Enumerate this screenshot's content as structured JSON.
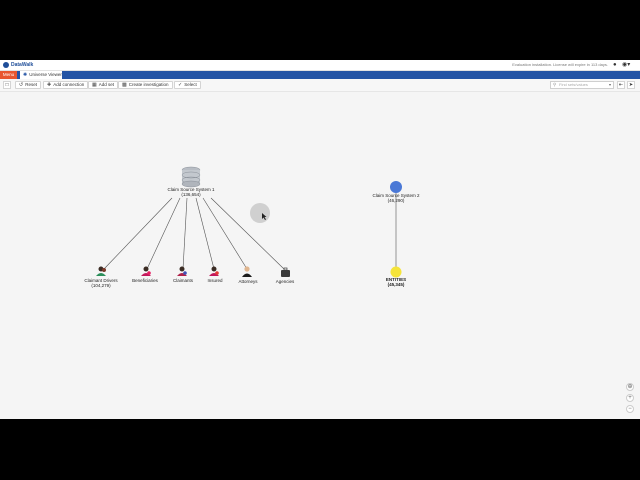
{
  "app": {
    "brand": "DataWalk",
    "evaluation_message": "Evaluation installation. License will expire in 113 days.",
    "menu_label": "Menu",
    "active_tab": "Universe Viewer"
  },
  "toolbar": {
    "reset": "Reset",
    "add_connection": "Add connection",
    "add_set": "Add set",
    "create_investigation": "Create investigation",
    "select": "Select",
    "search_placeholder": "Find sets/values"
  },
  "nodes": {
    "source1": {
      "name": "Claim Source System 1",
      "count": "(136,654)"
    },
    "source2": {
      "name": "Claim Source System 2",
      "count": "(46,290)"
    },
    "claimant_drivers": {
      "name": "Claimant Drivers",
      "count": "(104,279)"
    },
    "beneficiaries": {
      "name": "Beneficiaries"
    },
    "claimants": {
      "name": "Claimants"
    },
    "insured": {
      "name": "Insured"
    },
    "attorneys": {
      "name": "Attorneys"
    },
    "agencies": {
      "name": "Agencies"
    },
    "entities": {
      "name": "ENTITIES",
      "count": "(45,345)"
    }
  },
  "colors": {
    "tab_bar": "#2454a5",
    "menu_tab": "#e8572f",
    "source2_node": "#4a78d6",
    "entities_node": "#f5e43a",
    "edge": "#555555"
  },
  "icons": {
    "database": "database-icon",
    "person": "person-icon",
    "cursor": "cursor-icon"
  }
}
